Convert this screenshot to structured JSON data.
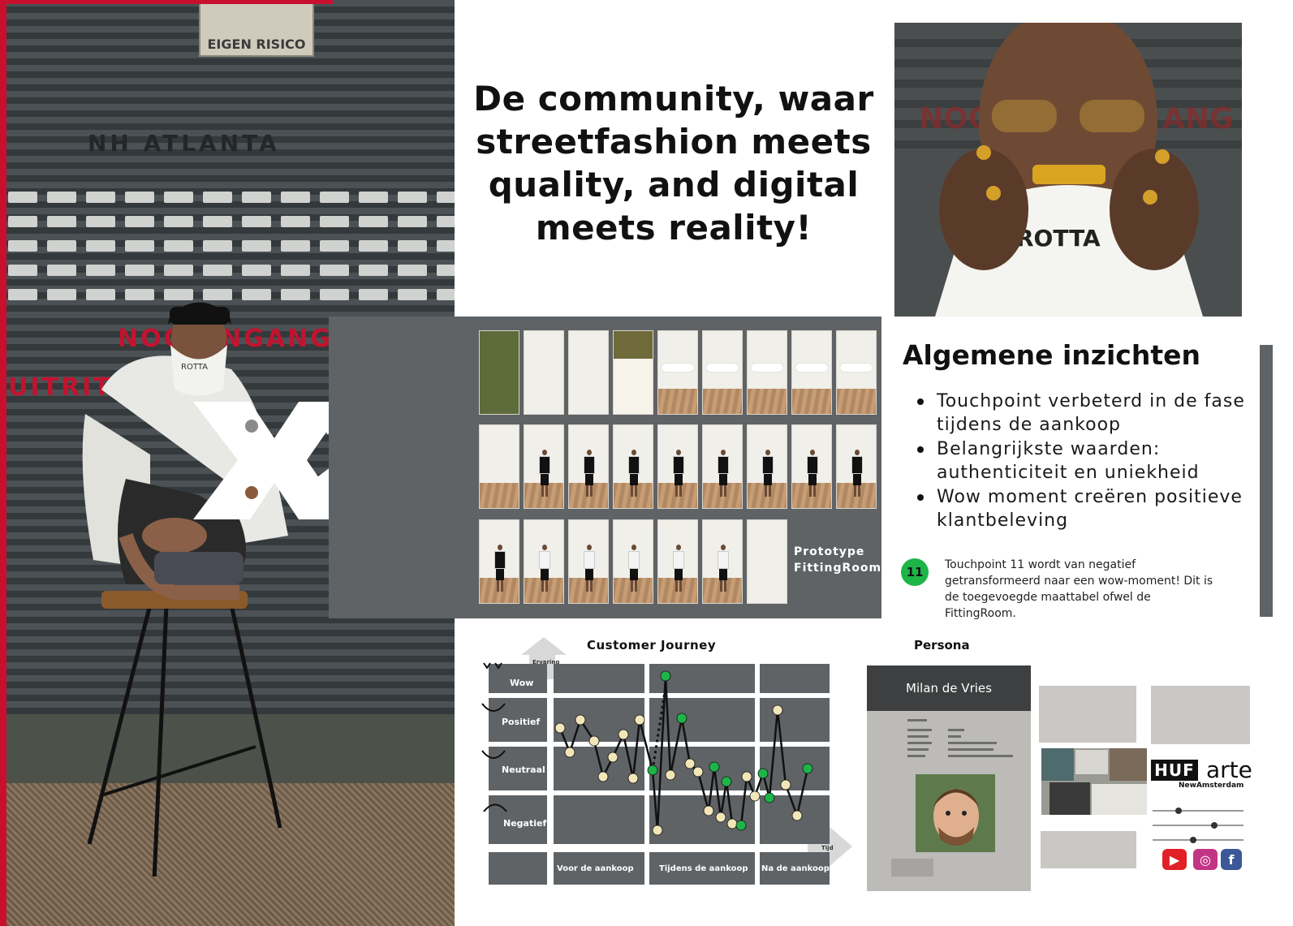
{
  "left_photo": {
    "sign_text": "EIGEN RISICO",
    "wall_text": "NH   ATLANTA",
    "red_text_1": "NOODINGANG",
    "red_text_2": "UITRIT"
  },
  "headline": "De community, waar streetfashion meets quality, and digital meets reality!",
  "prototype": {
    "label_line1": "Prototype",
    "label_line2": "FittingRoom"
  },
  "insights": {
    "title": "Algemene inzichten",
    "items": [
      "Touchpoint verbeterd in de fase tijdens de aankoop",
      "Belangrijkste waarden: authenticiteit en uniekheid",
      "Wow moment creëren positieve klantbeleving"
    ],
    "touchpoint_badge": "11",
    "touchpoint_text": "Touchpoint 11 wordt van negatief getransformeerd naar een wow-moment! Dit is de toegevoegde maattabel ofwel de FittingRoom."
  },
  "customer_journey": {
    "title": "Customer Journey",
    "rows": [
      "Wow",
      "Positief",
      "Neutraal",
      "Negatief"
    ],
    "phases": [
      "Voor de aankoop",
      "Tijdens de aankoop",
      "Na de aankoop"
    ],
    "arrow_label": "Ervaring",
    "time_label": "Tijd"
  },
  "persona": {
    "title": "Persona",
    "name": "Milan de Vries"
  },
  "brands": {
    "huf": "HUF",
    "arte": "arte",
    "arte_sub": "NewAmsterdam"
  },
  "colors": {
    "accent_red": "#c8102e",
    "panel_grey": "#5f6366",
    "wow_green": "#1db548"
  }
}
